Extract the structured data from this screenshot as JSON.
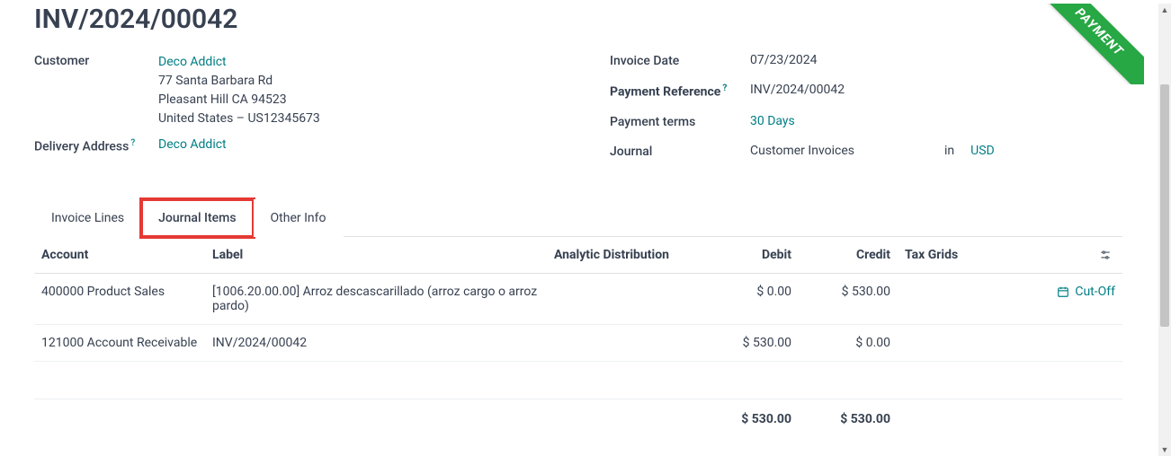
{
  "ribbon": {
    "text": "PAYMENT"
  },
  "invoice": {
    "title": "INV/2024/00042",
    "customer_label": "Customer",
    "customer_name": "Deco Addict",
    "address_lines": [
      "77 Santa Barbara Rd",
      "Pleasant Hill CA 94523",
      "United States – US12345673"
    ],
    "delivery_label": "Delivery Address",
    "delivery_value": "Deco Addict"
  },
  "right": {
    "invoice_date_label": "Invoice Date",
    "invoice_date": "07/23/2024",
    "payment_ref_label": "Payment Reference",
    "payment_ref": "INV/2024/00042",
    "payment_terms_label": "Payment terms",
    "payment_terms": "30 Days",
    "journal_label": "Journal",
    "journal_value": "Customer Invoices",
    "in_label": "in",
    "currency": "USD"
  },
  "tabs": {
    "invoice_lines": "Invoice Lines",
    "journal_items": "Journal Items",
    "other_info": "Other Info"
  },
  "table": {
    "headers": {
      "account": "Account",
      "label": "Label",
      "analytic": "Analytic Distribution",
      "debit": "Debit",
      "credit": "Credit",
      "tax": "Tax Grids"
    },
    "rows": [
      {
        "account": "400000 Product Sales",
        "label": "[1006.20.00.00] Arroz descascarillado (arroz cargo o arroz pardo)",
        "analytic": "",
        "debit": "$ 0.00",
        "credit": "$ 530.00",
        "cutoff": "Cut-Off"
      },
      {
        "account": "121000 Account Receivable",
        "label": "INV/2024/00042",
        "analytic": "",
        "debit": "$ 530.00",
        "credit": "$ 0.00",
        "cutoff": ""
      }
    ],
    "totals": {
      "debit": "$ 530.00",
      "credit": "$ 530.00"
    }
  }
}
